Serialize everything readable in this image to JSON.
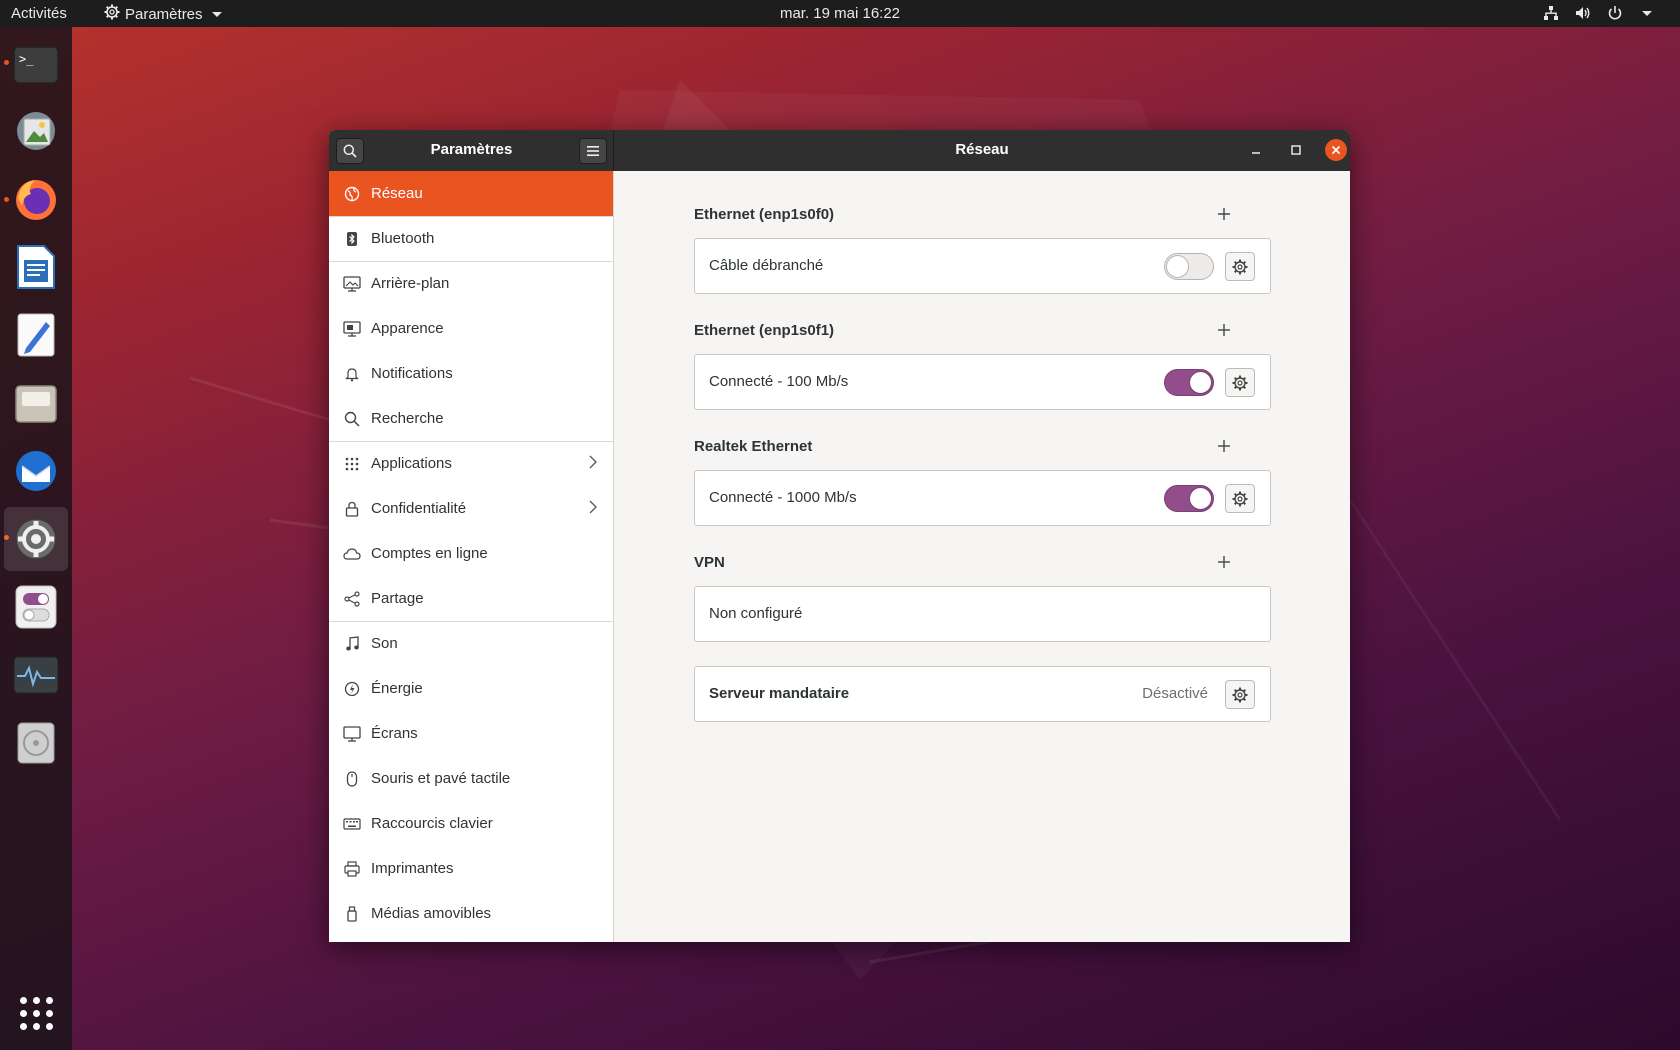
{
  "topbar": {
    "activities": "Activités",
    "app_menu": "Paramètres",
    "clock": "mar. 19 mai  16:22"
  },
  "dock": {
    "apps": [
      "terminal",
      "image-viewer",
      "firefox",
      "writer",
      "text-editor",
      "files",
      "thunderbird",
      "settings",
      "tweaks",
      "system-monitor",
      "disc"
    ],
    "running": [
      "terminal",
      "firefox",
      "settings"
    ]
  },
  "window": {
    "sidebar_title": "Paramètres",
    "title": "Réseau"
  },
  "sidebar": {
    "items": [
      {
        "label": "Réseau",
        "icon": "network-icon",
        "selected": true
      },
      {
        "label": "Bluetooth",
        "icon": "bluetooth-icon"
      },
      {
        "label": "Arrière-plan",
        "icon": "background-icon"
      },
      {
        "label": "Apparence",
        "icon": "appearance-icon"
      },
      {
        "label": "Notifications",
        "icon": "bell-icon"
      },
      {
        "label": "Recherche",
        "icon": "search-icon"
      },
      {
        "label": "Applications",
        "icon": "apps-grid-icon",
        "submenu": true
      },
      {
        "label": "Confidentialité",
        "icon": "lock-icon",
        "submenu": true
      },
      {
        "label": "Comptes en ligne",
        "icon": "cloud-icon"
      },
      {
        "label": "Partage",
        "icon": "share-icon"
      },
      {
        "label": "Son",
        "icon": "music-note-icon"
      },
      {
        "label": "Énergie",
        "icon": "power-icon"
      },
      {
        "label": "Écrans",
        "icon": "display-icon"
      },
      {
        "label": "Souris et pavé tactile",
        "icon": "mouse-icon"
      },
      {
        "label": "Raccourcis clavier",
        "icon": "keyboard-icon"
      },
      {
        "label": "Imprimantes",
        "icon": "printer-icon"
      },
      {
        "label": "Médias amovibles",
        "icon": "removable-media-icon"
      }
    ]
  },
  "content": {
    "sections": [
      {
        "title": "Ethernet (enp1s0f0)",
        "row": "Câble débranché",
        "toggle_on": false
      },
      {
        "title": "Ethernet (enp1s0f1)",
        "row": "Connecté - 100 Mb/s",
        "toggle_on": true
      },
      {
        "title": "Realtek Ethernet",
        "row": "Connecté - 1000 Mb/s",
        "toggle_on": true
      },
      {
        "title": "VPN",
        "row": "Non configuré"
      }
    ],
    "proxy": {
      "label": "Serveur mandataire",
      "status": "Désactivé"
    }
  },
  "colors": {
    "accent": "#e95420",
    "toggle_on": "#924d8b"
  }
}
